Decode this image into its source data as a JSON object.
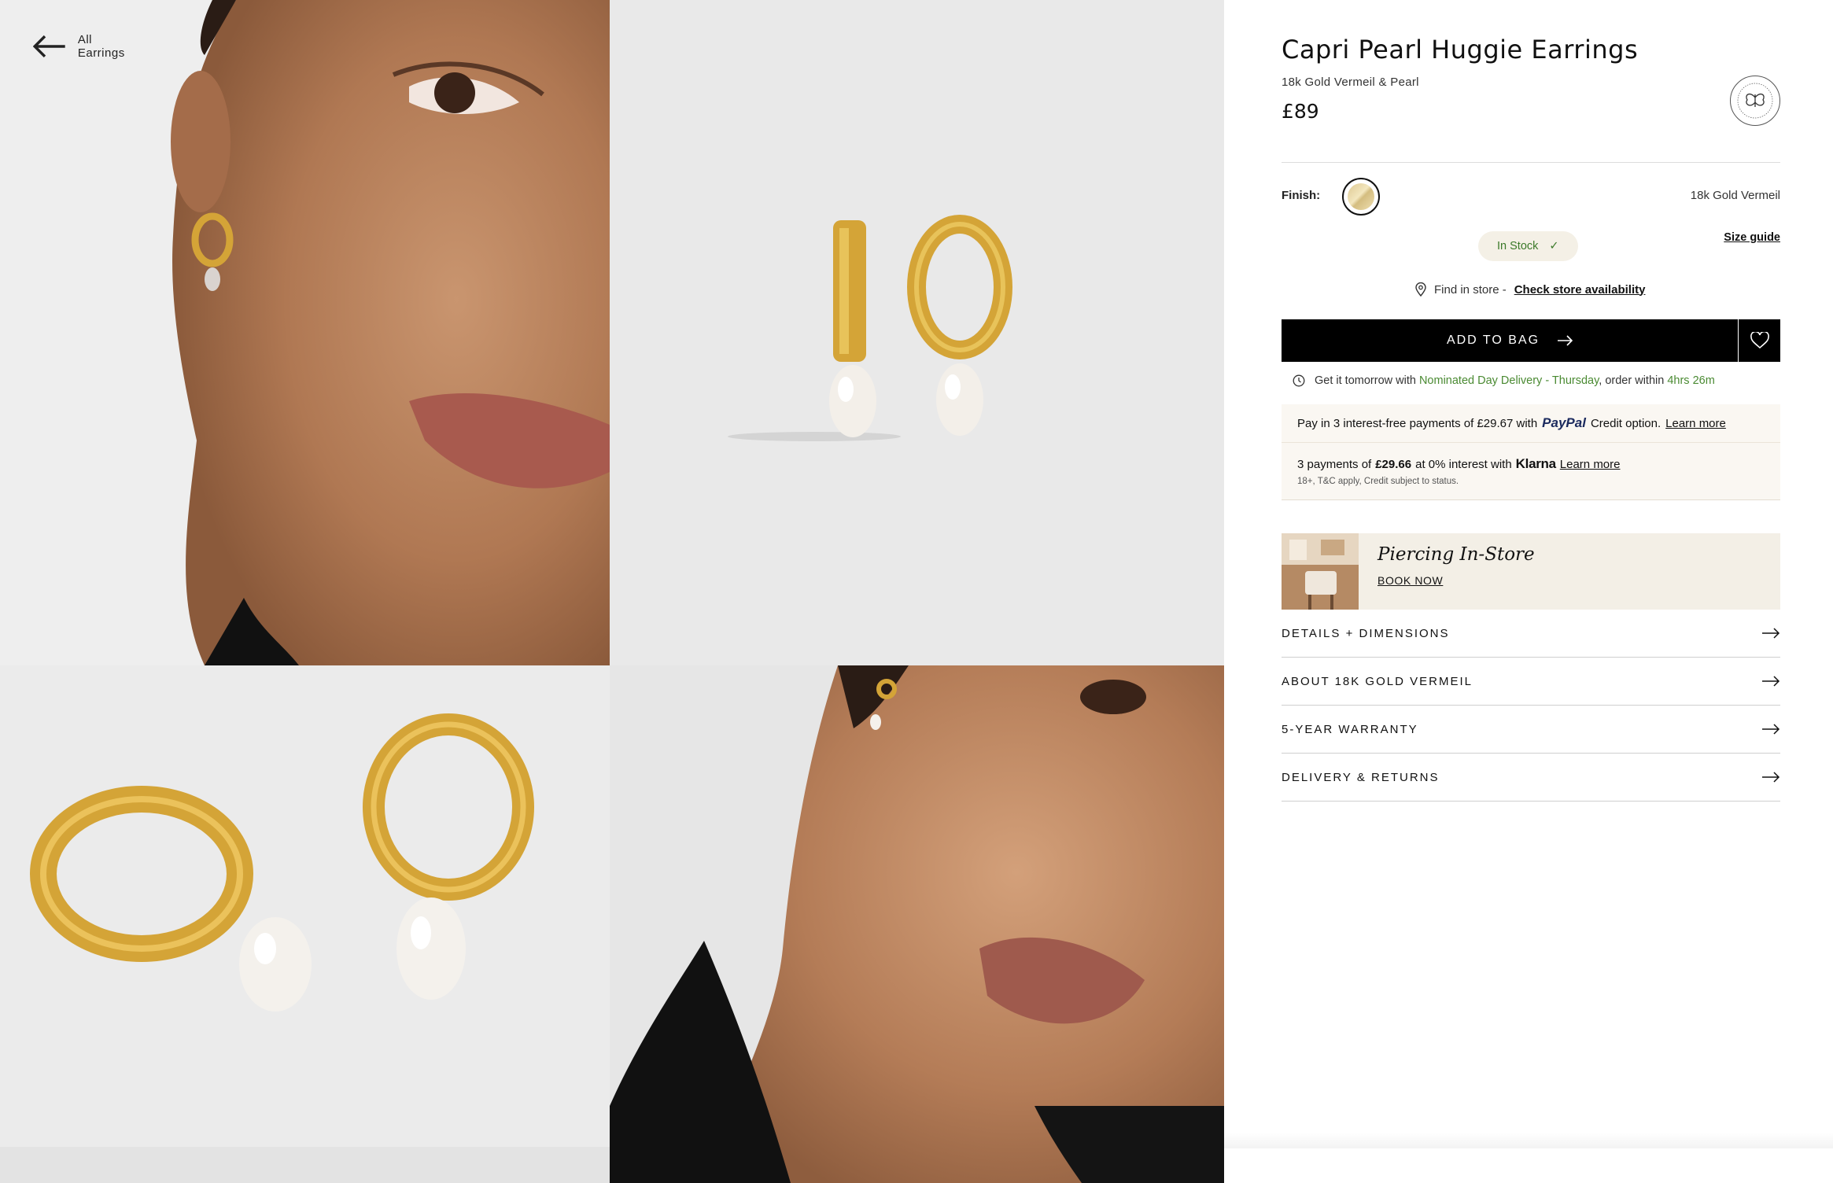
{
  "nav": {
    "back_label": "All Earrings"
  },
  "product": {
    "title": "Capri Pearl Huggie Earrings",
    "material": "18k Gold Vermeil & Pearl",
    "price": "£89"
  },
  "finish": {
    "label": "Finish:",
    "selected": "18k Gold Vermeil"
  },
  "stock": {
    "label": "In Stock",
    "check": "✓"
  },
  "size_guide": "Size guide",
  "find_store": {
    "prefix": "Find in store -",
    "link": "Check store availability"
  },
  "cta": {
    "add_to_bag": "ADD TO BAG",
    "wishlist_icon": "heart-icon"
  },
  "delivery": {
    "prefix": "Get it tomorrow with",
    "highlight": "Nominated Day Delivery - Thursday",
    "middle": ", order within",
    "countdown": "4hrs 26m"
  },
  "paypal": {
    "text": "Pay in 3 interest-free payments of £29.67 with",
    "brand": "PayPal",
    "suffix": "Credit option.",
    "link": "Learn more"
  },
  "klarna": {
    "pre": "3 payments of",
    "amount": "£29.66",
    "post": "at 0% interest with",
    "brand": "Klarna",
    "link": "Learn more",
    "note": "18+, T&C apply, Credit subject to status."
  },
  "piercing": {
    "title": "Piercing In-Store",
    "cta": "BOOK NOW"
  },
  "accordion": [
    {
      "label": "DETAILS + DIMENSIONS"
    },
    {
      "label": "ABOUT 18K GOLD VERMEIL"
    },
    {
      "label": "5-YEAR WARRANTY"
    },
    {
      "label": "DELIVERY & RETURNS"
    }
  ],
  "colors": {
    "accent_green": "#4a8a32",
    "stock_bg": "#f4f0e6",
    "gold": "#d4a437",
    "cta_bg": "#000000"
  }
}
